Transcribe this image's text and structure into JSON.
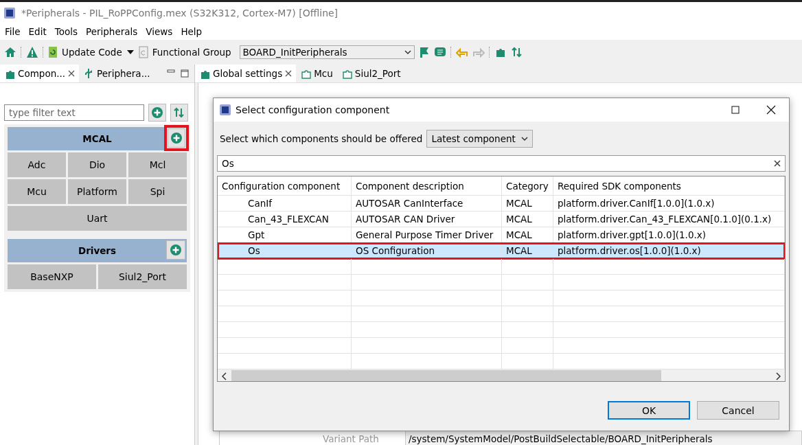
{
  "window": {
    "title": "*Peripherals - PIL_RoPPConfig.mex (S32K312, Cortex-M7) [Offline]"
  },
  "menu": [
    "File",
    "Edit",
    "Tools",
    "Peripherals",
    "Views",
    "Help"
  ],
  "toolbar": {
    "update_code": "Update Code",
    "functional_group_label": "Functional Group",
    "functional_group": "BOARD_InitPeripherals"
  },
  "left_tabs": [
    {
      "label": "Compon...",
      "selected": true
    },
    {
      "label": "Periphera...",
      "selected": false
    }
  ],
  "filter": {
    "placeholder": "type filter text"
  },
  "groups": [
    {
      "title": "MCAL",
      "highlighted": true,
      "rows": [
        {
          "items": [
            "Adc",
            "Dio",
            "Mcl"
          ]
        },
        {
          "items": [
            "Mcu",
            "Platform",
            "Spi"
          ]
        },
        {
          "items": [
            "Uart"
          ]
        }
      ]
    },
    {
      "title": "Drivers",
      "highlighted": false,
      "rows": [
        {
          "items": [
            "BaseNXP",
            "Siul2_Port"
          ]
        }
      ]
    }
  ],
  "editor_tabs": [
    {
      "label": "Global settings",
      "selected": true
    },
    {
      "label": "Mcu",
      "selected": false
    },
    {
      "label": "Siul2_Port",
      "selected": false
    }
  ],
  "background_field": {
    "label": "Variant Path",
    "value": "/system/SystemModel/PostBuildSelectable/BOARD_InitPeripherals"
  },
  "dialog": {
    "title": "Select configuration component",
    "offer_label": "Select which components should be offered",
    "offer_choice": "Latest component",
    "search": "Os",
    "columns": [
      "Configuration component",
      "Component description",
      "Category",
      "Required SDK components"
    ],
    "rows": [
      {
        "cells": [
          "CanIf",
          "AUTOSAR CanInterface",
          "MCAL",
          "platform.driver.CanIf[1.0.0](1.0.x)"
        ],
        "selected": false,
        "highlighted": false
      },
      {
        "cells": [
          "Can_43_FLEXCAN",
          "AUTOSAR CAN Driver",
          "MCAL",
          "platform.driver.Can_43_FLEXCAN[0.1.0](0.1.x)"
        ],
        "selected": false,
        "highlighted": false
      },
      {
        "cells": [
          "Gpt",
          "General Purpose Timer Driver",
          "MCAL",
          "platform.driver.gpt[1.0.0](1.0.x)"
        ],
        "selected": false,
        "highlighted": false
      },
      {
        "cells": [
          "Os",
          "OS Configuration",
          "MCAL",
          "platform.driver.os[1.0.0](1.0.x)"
        ],
        "selected": true,
        "highlighted": true
      }
    ],
    "buttons": [
      {
        "label": "OK",
        "default": true
      },
      {
        "label": "Cancel",
        "default": false
      }
    ]
  }
}
